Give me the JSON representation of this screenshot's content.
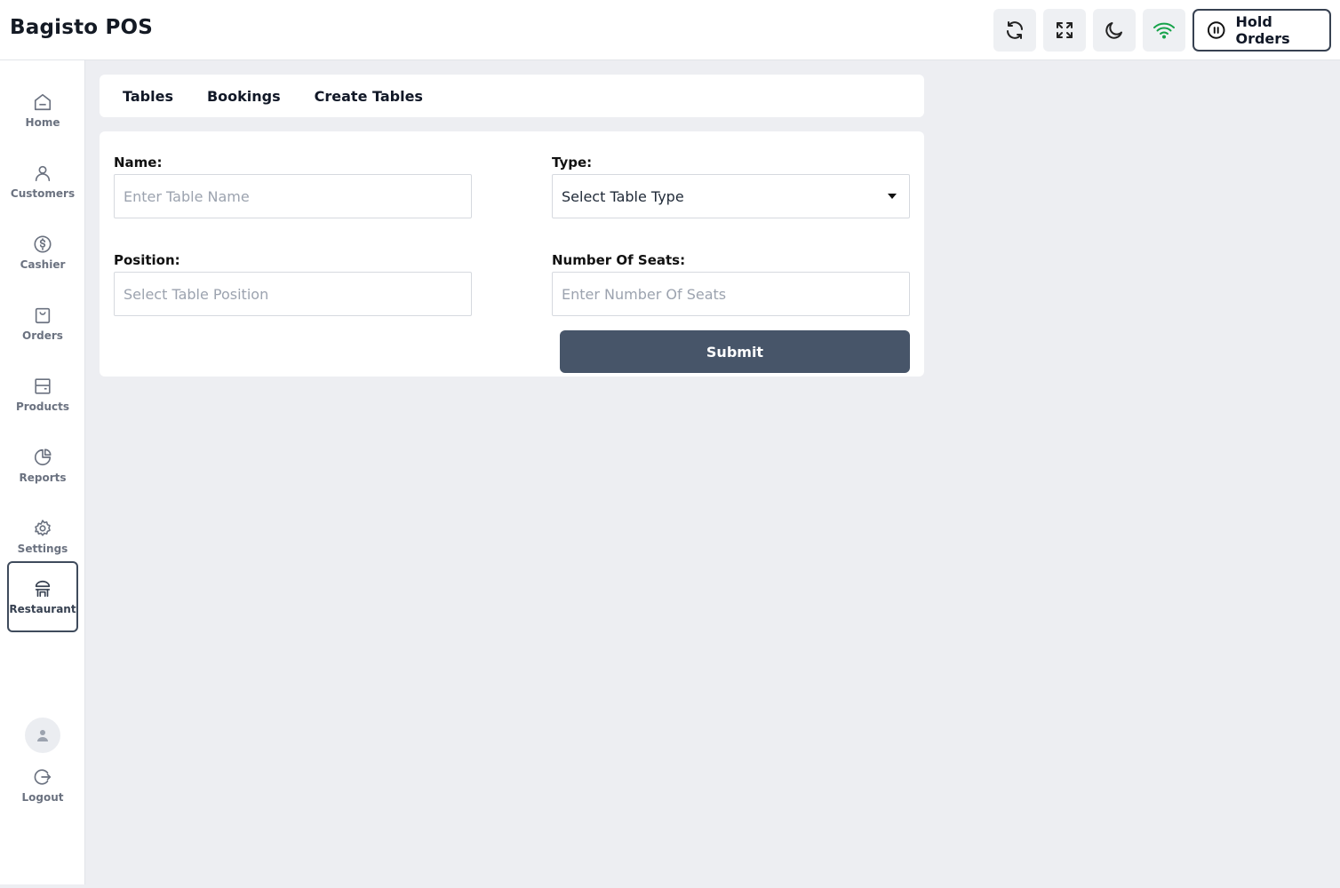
{
  "app": {
    "title": "Bagisto POS"
  },
  "header": {
    "hold_orders_label": "Hold Orders",
    "icons": [
      "refresh-icon",
      "fullscreen-icon",
      "moon-icon",
      "wifi-icon"
    ],
    "wifi_color": "#16a34a"
  },
  "sidebar": {
    "items": [
      {
        "label": "Home",
        "icon": "home-icon"
      },
      {
        "label": "Customers",
        "icon": "user-icon"
      },
      {
        "label": "Cashier",
        "icon": "dollar-icon"
      },
      {
        "label": "Orders",
        "icon": "bag-icon"
      },
      {
        "label": "Products",
        "icon": "box-icon"
      },
      {
        "label": "Reports",
        "icon": "pie-chart-icon"
      },
      {
        "label": "Settings",
        "icon": "gear-icon"
      },
      {
        "label": "Restaurant",
        "icon": "restaurant-icon",
        "active": true
      }
    ],
    "logout_label": "Logout"
  },
  "tabs": [
    {
      "label": "Tables"
    },
    {
      "label": "Bookings"
    },
    {
      "label": "Create Tables"
    }
  ],
  "form": {
    "name_label": "Name:",
    "name_placeholder": "Enter Table Name",
    "type_label": "Type:",
    "type_value": "Select Table Type",
    "position_label": "Position:",
    "position_placeholder": "Select Table Position",
    "seats_label": "Number Of Seats:",
    "seats_placeholder": "Enter Number Of Seats",
    "submit_label": "Submit"
  },
  "colors": {
    "accent": "#475569",
    "background": "#edeef2"
  }
}
